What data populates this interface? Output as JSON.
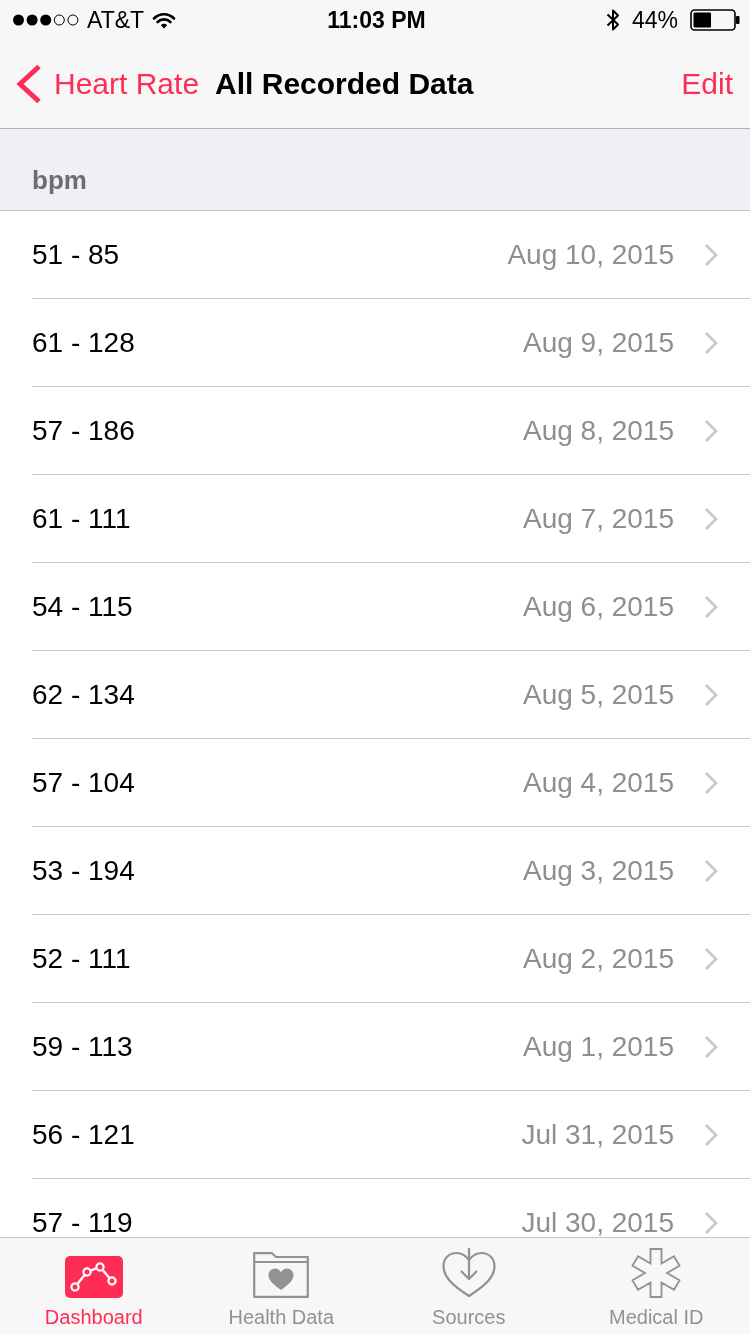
{
  "status_bar": {
    "carrier": "AT&T",
    "time": "11:03 PM",
    "battery": "44%"
  },
  "nav_bar": {
    "back": "Heart Rate",
    "title": "All Recorded Data",
    "action": "Edit"
  },
  "section": {
    "header": "bpm"
  },
  "rows": [
    {
      "range": "51 - 85",
      "date": "Aug 10, 2015"
    },
    {
      "range": "61 - 128",
      "date": "Aug 9, 2015"
    },
    {
      "range": "57 - 186",
      "date": "Aug 8, 2015"
    },
    {
      "range": "61 - 111",
      "date": "Aug 7, 2015"
    },
    {
      "range": "54 - 115",
      "date": "Aug 6, 2015"
    },
    {
      "range": "62 - 134",
      "date": "Aug 5, 2015"
    },
    {
      "range": "57 - 104",
      "date": "Aug 4, 2015"
    },
    {
      "range": "53 - 194",
      "date": "Aug 3, 2015"
    },
    {
      "range": "52 - 111",
      "date": "Aug 2, 2015"
    },
    {
      "range": "59 - 113",
      "date": "Aug 1, 2015"
    },
    {
      "range": "56 - 121",
      "date": "Jul 31, 2015"
    },
    {
      "range": "57 - 119",
      "date": "Jul 30, 2015"
    }
  ],
  "tab_bar": [
    {
      "label": "Dashboard",
      "selected": true
    },
    {
      "label": "Health Data",
      "selected": false
    },
    {
      "label": "Sources",
      "selected": false
    },
    {
      "label": "Medical ID",
      "selected": false
    }
  ]
}
